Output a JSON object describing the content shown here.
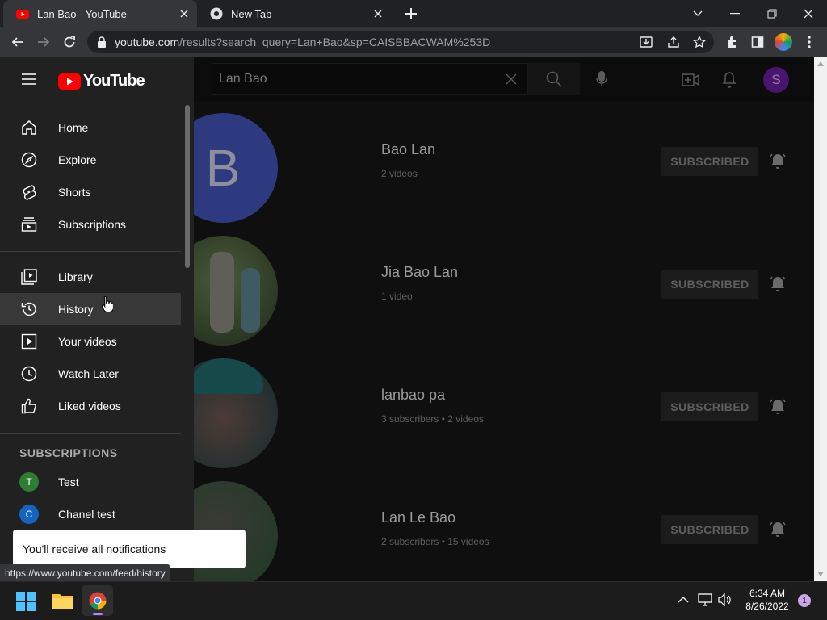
{
  "browser": {
    "tabs": [
      {
        "title": "Lan Bao - YouTube",
        "active": true
      },
      {
        "title": "New Tab",
        "active": false
      }
    ],
    "url_host": "youtube.com",
    "url_path": "/results?search_query=Lan+Bao&sp=CAISBBACWAM%253D",
    "status_url": "https://www.youtube.com/feed/history"
  },
  "masthead": {
    "logo_text": "YouTube",
    "search_value": "Lan Bao",
    "avatar_letter": "S"
  },
  "guide": {
    "items": [
      {
        "label": "Home",
        "icon": "home-icon"
      },
      {
        "label": "Explore",
        "icon": "compass-icon"
      },
      {
        "label": "Shorts",
        "icon": "shorts-icon"
      },
      {
        "label": "Subscriptions",
        "icon": "subscriptions-icon"
      }
    ],
    "library_items": [
      {
        "label": "Library",
        "icon": "library-icon"
      },
      {
        "label": "History",
        "icon": "history-icon"
      },
      {
        "label": "Your videos",
        "icon": "your-videos-icon"
      },
      {
        "label": "Watch Later",
        "icon": "clock-icon"
      },
      {
        "label": "Liked videos",
        "icon": "thumbs-up-icon"
      }
    ],
    "subscriptions_header": "SUBSCRIPTIONS",
    "subscriptions": [
      {
        "label": "Test",
        "letter": "T",
        "color": "#2e7d32"
      },
      {
        "label": "Chanel test",
        "letter": "C",
        "color": "#1565c0"
      }
    ]
  },
  "results": [
    {
      "name": "Bao Lan",
      "meta": "2 videos",
      "button": "SUBSCRIBED",
      "avatar_letter": "B"
    },
    {
      "name": "Jia Bao Lan",
      "meta": "1 video",
      "button": "SUBSCRIBED"
    },
    {
      "name": "lanbao pa",
      "meta": "3 subscribers • 2 videos",
      "button": "SUBSCRIBED"
    },
    {
      "name": "Lan Le Bao",
      "meta": "2 subscribers • 15 videos",
      "button": "SUBSCRIBED"
    }
  ],
  "toast": {
    "message": "You'll receive all notifications"
  },
  "taskbar": {
    "time": "6:34 AM",
    "date": "8/26/2022",
    "notification_count": "1"
  },
  "colors": {
    "youtube_red": "#ff0000",
    "avatar_purple": "#6a1b9a",
    "bao_lan_avatar": "#3f51b5"
  }
}
